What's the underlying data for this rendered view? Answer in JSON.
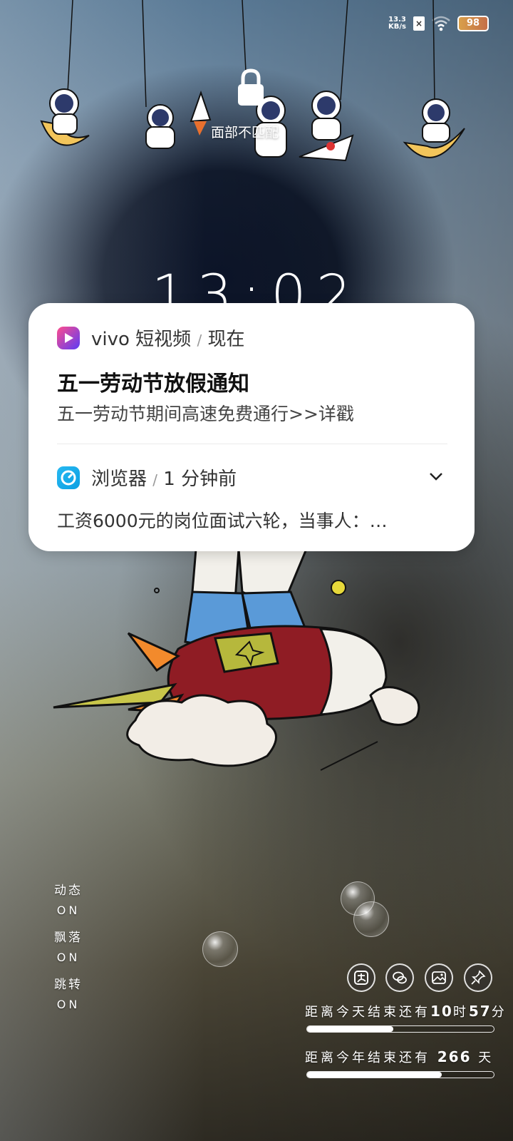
{
  "status_bar": {
    "net_speed_value": "13.3",
    "net_speed_unit": "KB/s",
    "sim_status": "×",
    "wifi_icon": "wifi-icon",
    "battery_level": "98"
  },
  "lock_screen": {
    "lock_hint": "面部不匹配",
    "time": "13:02"
  },
  "notifications": [
    {
      "app": "vivo 短视频",
      "separator": "/",
      "time": "现在",
      "title": "五一劳动节放假通知",
      "body": "五一劳动节期间高速免费通行>>详戳",
      "icon": "vivo-video-icon"
    },
    {
      "app": "浏览器",
      "separator": "/",
      "time": "1 分钟前",
      "body": "工资6000元的岗位面试六轮，当事人：…",
      "icon": "browser-icon"
    }
  ],
  "toggles": [
    {
      "label": "动态",
      "state": "ON"
    },
    {
      "label": "飘落",
      "state": "ON"
    },
    {
      "label": "跳转",
      "state": "ON"
    }
  ],
  "shortcuts": [
    "alipay-icon",
    "wechat-icon",
    "gallery-icon",
    "pin-icon"
  ],
  "countdowns": {
    "today_prefix": "距离今天结束还有",
    "today_hours": "10",
    "today_hours_unit": "时",
    "today_minutes": "57",
    "today_minutes_unit": "分",
    "today_progress": 0.46,
    "year_prefix": "距离今年结束还有",
    "year_days": "266",
    "year_days_unit": "天",
    "year_progress": 0.72
  },
  "colors": {
    "card_bg": "#ffffff",
    "vivo_icon": "#6b3cf0",
    "browser_icon": "#1aa8ea"
  }
}
